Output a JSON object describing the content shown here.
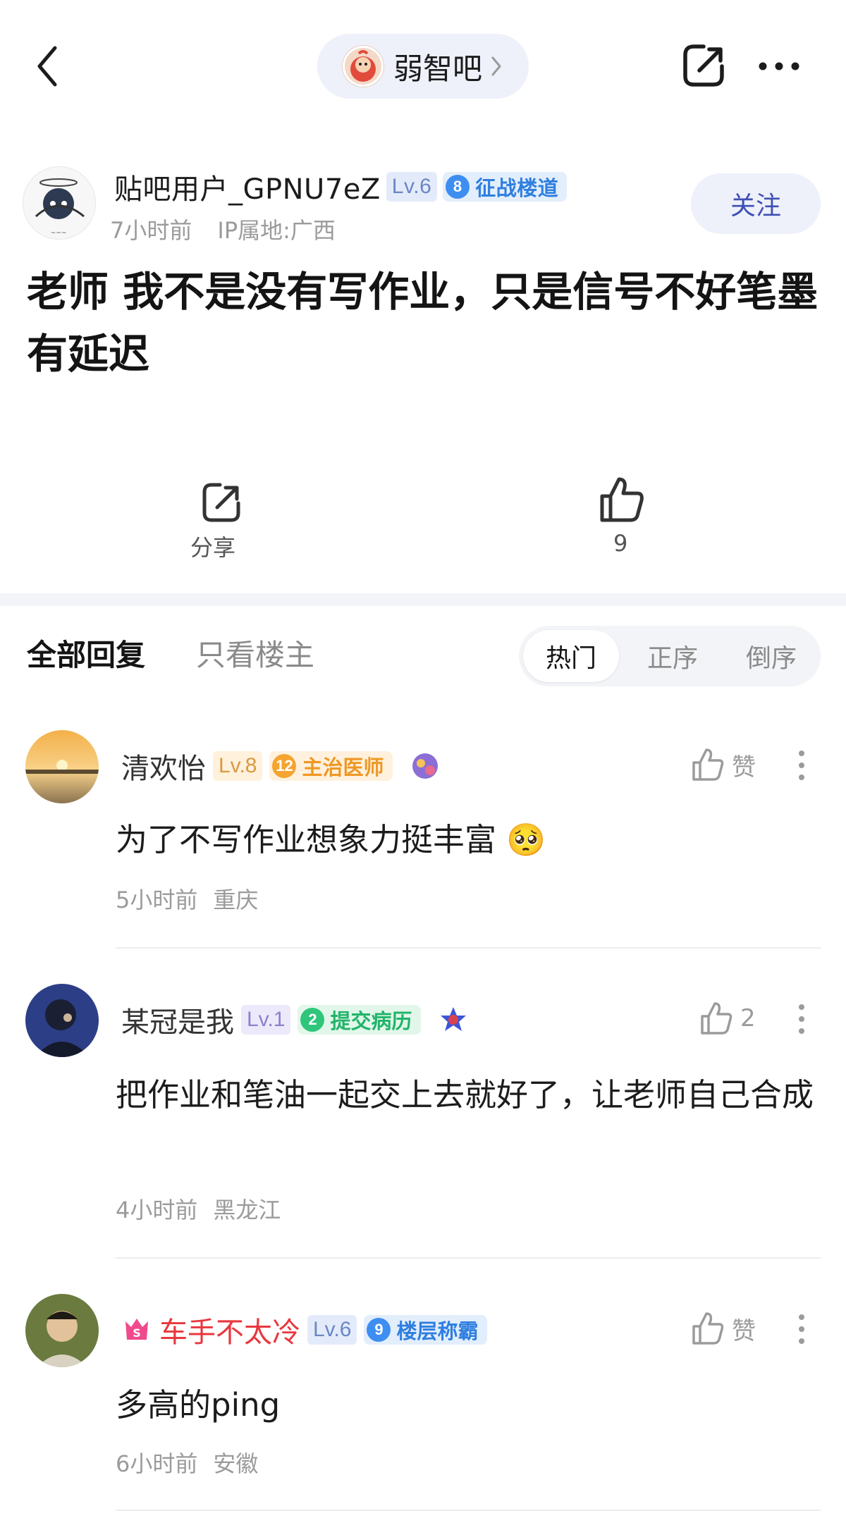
{
  "header": {
    "forum_name": "弱智吧"
  },
  "post": {
    "author": {
      "name": "贴吧用户_GPNU7eZ",
      "level": "Lv.6",
      "badge_num": "8",
      "badge_title": "征战楼道",
      "time": "7小时前",
      "ip": "IP属地:广西"
    },
    "follow_label": "关注",
    "title": "老师 我不是没有写作业，只是信号不好笔墨有延迟",
    "share_label": "分享",
    "like_count": "9"
  },
  "replies": {
    "tab_all": "全部回复",
    "tab_op": "只看楼主",
    "sort": [
      "热门",
      "正序",
      "倒序"
    ]
  },
  "comments": [
    {
      "name": "清欢怡",
      "level": "Lv.8",
      "badge_num": "12",
      "badge_title": "主治医师",
      "text": "为了不写作业想象力挺丰富 🥺",
      "time": "5小时前",
      "location": "重庆",
      "like_label": "赞"
    },
    {
      "name": "某冠是我",
      "level": "Lv.1",
      "badge_num": "2",
      "badge_title": "提交病历",
      "text": "把作业和笔油一起交上去就好了，让老师自己合成",
      "time": "4小时前",
      "location": "黑龙江",
      "like_label": "2"
    },
    {
      "name": "车手不太冷",
      "level": "Lv.6",
      "badge_num": "9",
      "badge_title": "楼层称霸",
      "text": "多高的ping",
      "time": "6小时前",
      "location": "安徽",
      "like_label": "赞"
    }
  ],
  "colors": {
    "accent": "#3e4fb3",
    "vip_name": "#e8373e",
    "badge_blue": "#2f7fe0",
    "badge_orange": "#ef9824",
    "badge_green": "#22b46a"
  },
  "icons": [
    "back-icon",
    "chevron-right-icon",
    "share-icon",
    "more-icon",
    "thumb-up-icon",
    "kebab-icon"
  ]
}
